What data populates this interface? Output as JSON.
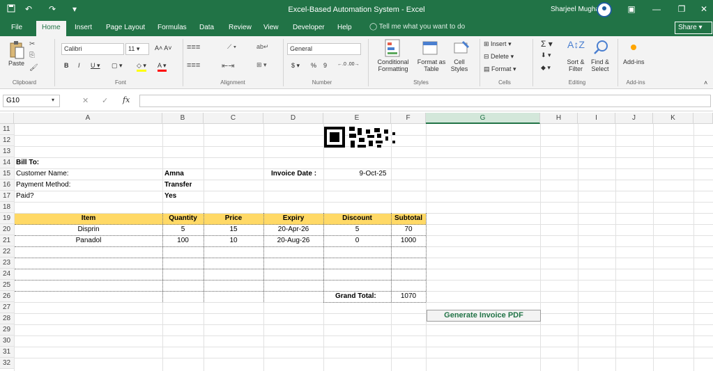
{
  "titlebar": {
    "title": "Excel-Based Automation System  -  Excel",
    "user": "Sharjeel Mughal",
    "qat_icons": [
      "save-icon",
      "undo-icon",
      "redo-icon",
      "customize-qat-icon"
    ]
  },
  "tabs": [
    "File",
    "Home",
    "Insert",
    "Page Layout",
    "Formulas",
    "Data",
    "Review",
    "View",
    "Developer",
    "Help"
  ],
  "active_tab": "Home",
  "tell_me": "Tell me what you want to do",
  "share": "Share",
  "ribbon": {
    "clipboard": {
      "label": "Clipboard",
      "paste": "Paste"
    },
    "font": {
      "label": "Font",
      "name": "Calibri",
      "size": "11"
    },
    "alignment": {
      "label": "Alignment"
    },
    "number": {
      "label": "Number",
      "format": "General",
      "currency": "$",
      "percent": "%",
      "comma": "9"
    },
    "styles": {
      "label": "Styles",
      "conditional": "Conditional Formatting",
      "format_table": "Format as Table",
      "cell_styles": "Cell Styles"
    },
    "cells": {
      "label": "Cells",
      "insert": "Insert",
      "delete": "Delete",
      "format": "Format"
    },
    "editing": {
      "label": "Editing",
      "sort": "Sort & Filter",
      "find": "Find & Select"
    },
    "addins": {
      "label": "Add-ins",
      "button": "Add-ins"
    }
  },
  "formula_bar": {
    "name_box": "G10",
    "fx": "fx",
    "content": ""
  },
  "columns": [
    "A",
    "B",
    "C",
    "D",
    "E",
    "F",
    "G",
    "H",
    "I",
    "J",
    "K"
  ],
  "selected_column": "G",
  "rows": [
    "11",
    "12",
    "13",
    "14",
    "15",
    "16",
    "17",
    "18",
    "19",
    "20",
    "21",
    "22",
    "23",
    "24",
    "25",
    "26",
    "27",
    "28",
    "29",
    "30",
    "31",
    "32"
  ],
  "invoice": {
    "bill_to": "Bill To:",
    "customer_label": "Customer Name:",
    "customer_value": "Amna",
    "payment_label": "Payment Method:",
    "payment_value": "Transfer",
    "paid_label": "Paid?",
    "paid_value": "Yes",
    "invoice_date_label": "Invoice Date :",
    "invoice_date_value": "9-Oct-25",
    "headers": [
      "Item",
      "Quantity",
      "Price",
      "Expiry",
      "Discount",
      "Subtotal"
    ],
    "items": [
      [
        "Disprin",
        "5",
        "15",
        "20-Apr-26",
        "5",
        "70"
      ],
      [
        "Panadol",
        "100",
        "10",
        "20-Aug-26",
        "0",
        "1000"
      ]
    ],
    "grand_total_label": "Grand Total:",
    "grand_total_value": "1070"
  },
  "generate_button": "Generate Invoice PDF",
  "colors": {
    "excel_green": "#217346",
    "header_fill": "#ffd966"
  }
}
